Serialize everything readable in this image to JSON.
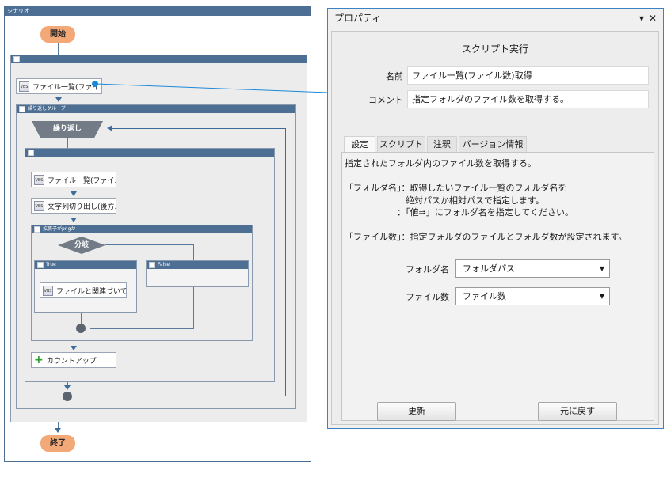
{
  "scenario": {
    "title": "シナリオ",
    "start_label": "開始",
    "end_label": "終了",
    "outer_group_label": "",
    "node_file_list_1": "ファイル一覧(ファイル数",
    "loop_group_label": "繰り返しグループ",
    "loop_label": "繰り返し",
    "inner_group_label": "",
    "node_file_list_2": "ファイル一覧(ファイル名...",
    "node_substring": "文字列切り出し(後方...",
    "condition_group_label": "拡張子がpngか",
    "branch_label": "分岐",
    "true_label": "True",
    "false_label": "False",
    "node_file_open": "ファイルと関連づいてい...",
    "node_count_up": "カウントアップ",
    "node_icon_text": "VBS"
  },
  "properties": {
    "title": "プロパティ",
    "pin_glyph": "▾",
    "close_glyph": "✕",
    "header": "スクリプト実行",
    "name_label": "名前",
    "name_value": "ファイル一覧(ファイル数)取得",
    "comment_label": "コメント",
    "comment_value": "指定フォルダのファイル数を取得する。",
    "tabs": [
      "設定",
      "スクリプト",
      "注釈",
      "バージョン情報"
    ],
    "active_tab": "設定",
    "description": "指定されたフォルダ内のファイル数を取得する。\n\n「フォルダ名」：取得したいファイル一覧のフォルダ名を\n　　　　　　　絶対パスか相対パスで指定します。\n　　　　　　：「値⇒」にフォルダ名を指定してください。\n\n「ファイル数」：指定フォルダのファイルとフォルダ数が設定されます。",
    "folder_label": "フォルダ名",
    "folder_value": "フォルダパス",
    "count_label": "ファイル数",
    "count_value": "ファイル数",
    "dropdown_glyph": "▼",
    "update_button": "更新",
    "revert_button": "元に戻す"
  },
  "colors": {
    "header_blue": "#4d6f93",
    "pill_orange": "#f3a877",
    "shape_gray": "#727b86",
    "connector_blue": "#1e88d8"
  }
}
